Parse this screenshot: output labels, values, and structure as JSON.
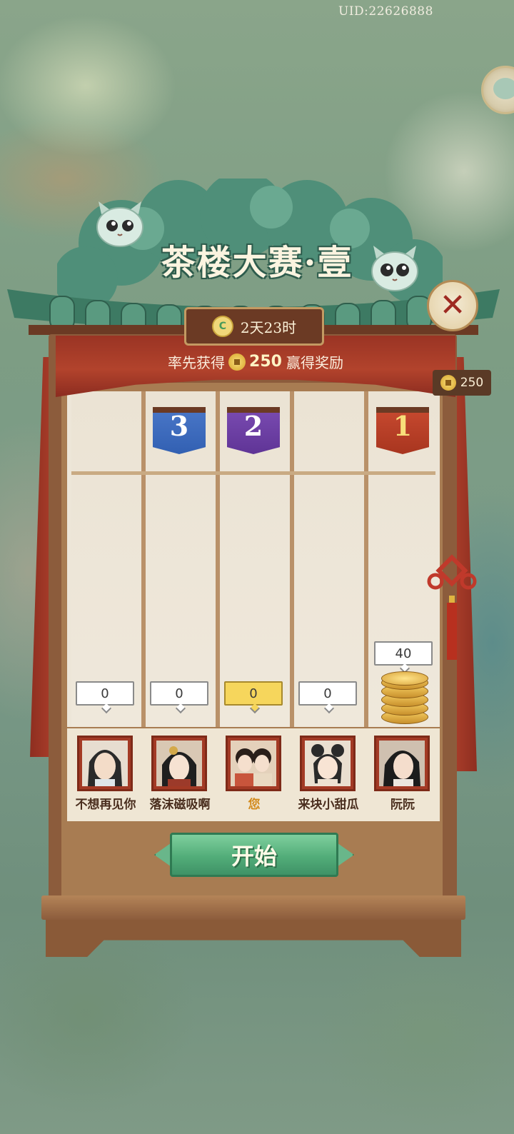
{
  "uid_label": "UID:22626888",
  "title": "茶楼大赛·壹",
  "timer": "2天23时",
  "subtitle": {
    "prefix": "率先获得",
    "amount": "250",
    "suffix": "赢得奖励"
  },
  "reward_tag": "250",
  "lanes": [
    {
      "rank": null,
      "score": "0",
      "name": "不想再见你",
      "is_me": false
    },
    {
      "rank": "3",
      "score": "0",
      "name": "落沫磁吸啊",
      "is_me": false
    },
    {
      "rank": "2",
      "score": "0",
      "name": "您",
      "is_me": true
    },
    {
      "rank": null,
      "score": "0",
      "name": "来块小甜瓜",
      "is_me": false
    },
    {
      "rank": "1",
      "score": "40",
      "name": "阮阮",
      "is_me": false
    }
  ],
  "start_button": "开始",
  "colors": {
    "accent_green": "#52ad79",
    "curtain_red": "#b2432c",
    "wood_brown": "#8c5c3c",
    "my_score_yellow": "#f6d65c"
  },
  "icons": [
    "close-icon",
    "clock-icon",
    "coin-icon",
    "coin-stack-icon",
    "chinese-knot-icon",
    "pet-cat-icon"
  ]
}
